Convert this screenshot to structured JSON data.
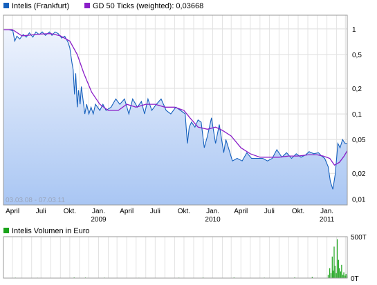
{
  "legend": {
    "series1_label": "Intelis (Frankfurt)",
    "series1_color": "#1560bd",
    "series2_label": "GD 50 Ticks (weighted): 0,03668",
    "series2_color": "#8a1ec8",
    "volume_label": "Intelis Volumen in Euro",
    "volume_color": "#1aa31a"
  },
  "date_range_label": "03.03.08 - 07.03.11",
  "chart_data": [
    {
      "type": "area",
      "scale": "log",
      "y_ticks": [
        {
          "value": 1,
          "label": "1"
        },
        {
          "value": 0.5,
          "label": "0,5"
        },
        {
          "value": 0.2,
          "label": "0,2"
        },
        {
          "value": 0.1,
          "label": "0,1"
        },
        {
          "value": 0.05,
          "label": "0,05"
        },
        {
          "value": 0.02,
          "label": "0,02"
        },
        {
          "value": 0.01,
          "label": "0,01"
        }
      ],
      "x_ticks": [
        {
          "date": "2008-04-01",
          "label": "April",
          "year": ""
        },
        {
          "date": "2008-07-01",
          "label": "Juli",
          "year": ""
        },
        {
          "date": "2008-10-01",
          "label": "Okt.",
          "year": ""
        },
        {
          "date": "2009-01-01",
          "label": "Jan.",
          "year": "2009"
        },
        {
          "date": "2009-04-01",
          "label": "April",
          "year": ""
        },
        {
          "date": "2009-07-01",
          "label": "Juli",
          "year": ""
        },
        {
          "date": "2009-10-01",
          "label": "Okt.",
          "year": ""
        },
        {
          "date": "2010-01-01",
          "label": "Jan.",
          "year": "2010"
        },
        {
          "date": "2010-04-01",
          "label": "April",
          "year": ""
        },
        {
          "date": "2010-07-01",
          "label": "Juli",
          "year": ""
        },
        {
          "date": "2010-10-01",
          "label": "Okt.",
          "year": ""
        },
        {
          "date": "2011-01-01",
          "label": "Jan.",
          "year": "2011"
        }
      ],
      "x_start": "2008-03-03",
      "x_end": "2011-03-07",
      "ylim": [
        0.0085,
        1.45
      ],
      "series": [
        {
          "name": "Intelis (Frankfurt)",
          "x": [
            "2008-03-03",
            "2008-03-20",
            "2008-04-02",
            "2008-04-08",
            "2008-04-15",
            "2008-04-24",
            "2008-05-05",
            "2008-05-15",
            "2008-05-25",
            "2008-06-05",
            "2008-06-15",
            "2008-06-25",
            "2008-07-05",
            "2008-07-15",
            "2008-07-28",
            "2008-08-05",
            "2008-08-15",
            "2008-08-25",
            "2008-09-05",
            "2008-09-15",
            "2008-09-25",
            "2008-10-01",
            "2008-10-08",
            "2008-10-12",
            "2008-10-16",
            "2008-10-20",
            "2008-10-25",
            "2008-10-29",
            "2008-11-03",
            "2008-11-07",
            "2008-11-12",
            "2008-11-18",
            "2008-11-24",
            "2008-12-01",
            "2008-12-08",
            "2008-12-15",
            "2008-12-22",
            "2009-01-05",
            "2009-01-15",
            "2009-01-25",
            "2009-02-10",
            "2009-02-25",
            "2009-03-10",
            "2009-03-25",
            "2009-04-08",
            "2009-04-20",
            "2009-05-05",
            "2009-05-18",
            "2009-05-28",
            "2009-06-08",
            "2009-06-20",
            "2009-07-05",
            "2009-07-20",
            "2009-08-05",
            "2009-08-20",
            "2009-09-05",
            "2009-09-20",
            "2009-10-05",
            "2009-10-12",
            "2009-10-18",
            "2009-10-25",
            "2009-11-05",
            "2009-11-15",
            "2009-11-25",
            "2009-12-05",
            "2009-12-15",
            "2009-12-28",
            "2010-01-10",
            "2010-01-22",
            "2010-02-05",
            "2010-02-12",
            "2010-02-20",
            "2010-03-05",
            "2010-03-20",
            "2010-04-05",
            "2010-04-20",
            "2010-05-05",
            "2010-05-25",
            "2010-06-10",
            "2010-06-25",
            "2010-07-10",
            "2010-07-25",
            "2010-08-10",
            "2010-08-25",
            "2010-09-10",
            "2010-09-25",
            "2010-10-10",
            "2010-10-25",
            "2010-11-05",
            "2010-11-20",
            "2010-12-05",
            "2010-12-15",
            "2010-12-25",
            "2011-01-05",
            "2011-01-12",
            "2011-01-20",
            "2011-01-28",
            "2011-02-05",
            "2011-02-12",
            "2011-02-20",
            "2011-02-28",
            "2011-03-07"
          ],
          "values": [
            0.98,
            0.98,
            0.95,
            0.72,
            0.82,
            0.76,
            0.86,
            0.8,
            0.9,
            0.8,
            0.92,
            0.86,
            0.92,
            0.84,
            0.92,
            0.84,
            0.92,
            0.88,
            0.78,
            0.82,
            0.7,
            0.6,
            0.4,
            0.33,
            0.17,
            0.3,
            0.12,
            0.19,
            0.13,
            0.21,
            0.15,
            0.1,
            0.13,
            0.1,
            0.12,
            0.1,
            0.13,
            0.11,
            0.13,
            0.11,
            0.12,
            0.15,
            0.13,
            0.15,
            0.1,
            0.15,
            0.12,
            0.14,
            0.1,
            0.15,
            0.11,
            0.13,
            0.15,
            0.11,
            0.1,
            0.12,
            0.11,
            0.1,
            0.045,
            0.07,
            0.08,
            0.07,
            0.085,
            0.08,
            0.04,
            0.055,
            0.09,
            0.045,
            0.075,
            0.035,
            0.05,
            0.04,
            0.028,
            0.03,
            0.028,
            0.035,
            0.03,
            0.03,
            0.03,
            0.028,
            0.03,
            0.038,
            0.031,
            0.035,
            0.03,
            0.034,
            0.031,
            0.033,
            0.036,
            0.034,
            0.035,
            0.032,
            0.03,
            0.024,
            0.016,
            0.013,
            0.02,
            0.045,
            0.04,
            0.05,
            0.045,
            0.045
          ]
        },
        {
          "name": "GD 50 Ticks (weighted): 0,03668",
          "x": [
            "2008-03-03",
            "2008-04-01",
            "2008-05-01",
            "2008-06-01",
            "2008-07-01",
            "2008-08-01",
            "2008-09-01",
            "2008-10-01",
            "2008-10-25",
            "2008-11-15",
            "2008-12-10",
            "2009-01-05",
            "2009-02-01",
            "2009-03-05",
            "2009-04-01",
            "2009-05-01",
            "2009-06-01",
            "2009-07-01",
            "2009-08-01",
            "2009-09-01",
            "2009-10-01",
            "2009-10-20",
            "2009-11-15",
            "2009-12-15",
            "2010-01-10",
            "2010-02-01",
            "2010-03-01",
            "2010-04-01",
            "2010-05-01",
            "2010-06-01",
            "2010-07-01",
            "2010-08-01",
            "2010-09-01",
            "2010-10-01",
            "2010-11-01",
            "2010-12-01",
            "2010-12-20",
            "2011-01-10",
            "2011-01-25",
            "2011-02-10",
            "2011-02-25",
            "2011-03-07"
          ],
          "values": [
            0.98,
            0.98,
            0.83,
            0.85,
            0.87,
            0.88,
            0.83,
            0.72,
            0.5,
            0.3,
            0.18,
            0.13,
            0.11,
            0.11,
            0.13,
            0.12,
            0.13,
            0.13,
            0.12,
            0.12,
            0.11,
            0.09,
            0.07,
            0.066,
            0.07,
            0.064,
            0.055,
            0.04,
            0.034,
            0.031,
            0.031,
            0.031,
            0.032,
            0.032,
            0.033,
            0.033,
            0.032,
            0.03,
            0.025,
            0.027,
            0.032,
            0.037
          ]
        }
      ]
    },
    {
      "type": "bar",
      "y_ticks": [
        {
          "value": 0,
          "label": "0T"
        },
        {
          "value": 500000,
          "label": "500T"
        }
      ],
      "ylim": [
        0,
        500000
      ],
      "x": [
        "2008-04-10",
        "2008-06-20",
        "2008-10-15",
        "2008-11-20",
        "2009-01-20",
        "2009-05-10",
        "2009-09-15",
        "2009-12-01",
        "2010-03-10",
        "2010-06-15",
        "2010-09-20",
        "2010-11-15",
        "2011-01-05",
        "2011-01-10",
        "2011-01-14",
        "2011-01-18",
        "2011-01-21",
        "2011-01-24",
        "2011-01-27",
        "2011-01-31",
        "2011-02-03",
        "2011-02-07",
        "2011-02-10",
        "2011-02-14",
        "2011-02-17",
        "2011-02-21",
        "2011-02-24",
        "2011-02-28",
        "2011-03-03",
        "2011-03-07"
      ],
      "values": [
        6000,
        5000,
        8000,
        7000,
        6000,
        5000,
        6000,
        7000,
        8000,
        6000,
        9000,
        15000,
        40000,
        120000,
        60000,
        260000,
        90000,
        380000,
        150000,
        60000,
        470000,
        220000,
        120000,
        80000,
        160000,
        40000,
        70000,
        30000,
        50000,
        30000
      ]
    }
  ]
}
